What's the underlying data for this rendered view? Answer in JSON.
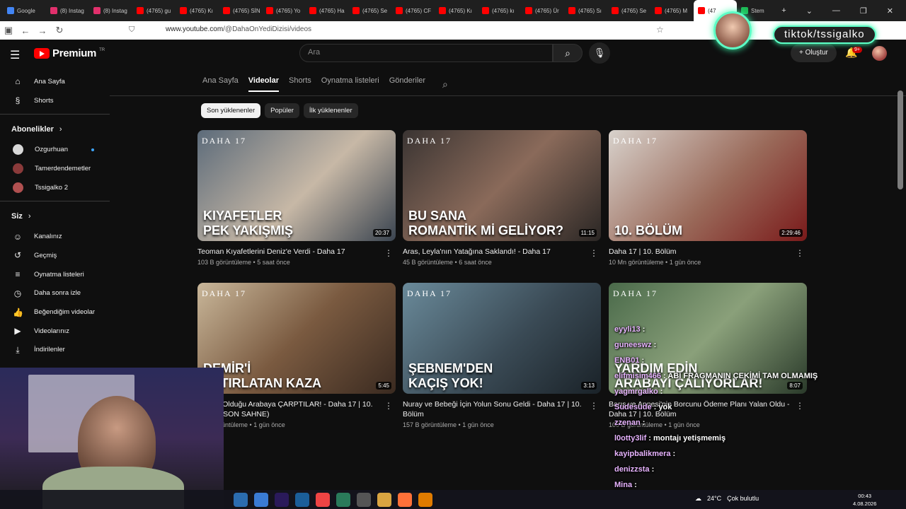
{
  "browser": {
    "tabs": [
      {
        "label": "Google",
        "color": "#4285f4"
      },
      {
        "label": "(8) Instag",
        "color": "#e1306c"
      },
      {
        "label": "(8) Instag",
        "color": "#e1306c"
      },
      {
        "label": "(4765) gu",
        "color": "#ff0000"
      },
      {
        "label": "(4765) Kı",
        "color": "#ff0000"
      },
      {
        "label": "(4765) SİN",
        "color": "#ff0000"
      },
      {
        "label": "(4765) Yo",
        "color": "#ff0000"
      },
      {
        "label": "(4765) Ha",
        "color": "#ff0000"
      },
      {
        "label": "(4765) Se",
        "color": "#ff0000"
      },
      {
        "label": "(4765) CF",
        "color": "#ff0000"
      },
      {
        "label": "(4765) Kı",
        "color": "#ff0000"
      },
      {
        "label": "(4765) kı",
        "color": "#ff0000"
      },
      {
        "label": "(4765) Ür",
        "color": "#ff0000"
      },
      {
        "label": "(4765) Sı",
        "color": "#ff0000"
      },
      {
        "label": "(4765) Se",
        "color": "#ff0000"
      },
      {
        "label": "(4765) M",
        "color": "#ff0000"
      },
      {
        "label": "(47",
        "color": "#ff0000",
        "active": true
      },
      {
        "label": "Stem",
        "color": "#1db954"
      }
    ],
    "new_tab": "+",
    "url_host": "www.youtube.com",
    "url_path": "/@DahaOnYediDizisi/videos"
  },
  "youtube": {
    "logo_text": "Premium",
    "logo_country": "TR",
    "search_placeholder": "Ara",
    "create_label": "Oluştur",
    "notif_count": "9+"
  },
  "sidebar": {
    "main": [
      {
        "label": "Ana Sayfa",
        "icon": "home-icon",
        "glyph": "⌂"
      },
      {
        "label": "Shorts",
        "icon": "shorts-icon",
        "glyph": "§"
      }
    ],
    "subs_title": "Abonelikler",
    "subs": [
      {
        "label": "Ozgurhuan",
        "color": "#d8d8d8",
        "new": true
      },
      {
        "label": "Tamerdendemetler",
        "color": "#8a3a3a",
        "new": false
      },
      {
        "label": "Tssigalko 2",
        "color": "#b05050",
        "new": false
      }
    ],
    "you_title": "Siz",
    "you": [
      {
        "label": "Kanalınız",
        "icon": "account-icon",
        "glyph": "☺"
      },
      {
        "label": "Geçmiş",
        "icon": "history-icon",
        "glyph": "↺"
      },
      {
        "label": "Oynatma listeleri",
        "icon": "playlist-icon",
        "glyph": "≡"
      },
      {
        "label": "Daha sonra izle",
        "icon": "clock-icon",
        "glyph": "◷"
      },
      {
        "label": "Beğendiğim videolar",
        "icon": "like-icon",
        "glyph": "👍"
      },
      {
        "label": "Videolarınız",
        "icon": "your-videos-icon",
        "glyph": "▶"
      },
      {
        "label": "İndirilenler",
        "icon": "download-icon",
        "glyph": "⤓"
      }
    ]
  },
  "channel_tabs": [
    "Ana Sayfa",
    "Videolar",
    "Shorts",
    "Oynatma listeleri",
    "Gönderiler"
  ],
  "active_tab": "Videolar",
  "chips": [
    "Son yüklenenler",
    "Popüler",
    "İlk yüklenenler"
  ],
  "videos": [
    {
      "brand": "DAHA 17",
      "caption": "KIYAFETLER\nPEK YAKIŞMIŞ",
      "duration": "20:37",
      "title": "Teoman Kıyafetlerini Deniz'e Verdi - Daha 17",
      "meta": "103 B görüntüleme • 5 saat önce",
      "bg": "linear-gradient(135deg,#5c6b7a,#c7b8a6 55%,#3a4450)"
    },
    {
      "brand": "DAHA 17",
      "caption": "BU SANA\nROMANTİK Mİ GELİYOR?",
      "duration": "11:15",
      "title": "Aras, Leyla'nın Yatağına Saklandı! - Daha 17",
      "meta": "45 B görüntüleme • 6 saat önce",
      "bg": "linear-gradient(135deg,#3a3432,#8a6a5a 50%,#2a2624)"
    },
    {
      "brand": "DAHA 17",
      "caption": "10. BÖLÜM",
      "duration": "2:29:46",
      "title": "Daha 17 | 10. Bölüm",
      "meta": "10 Mn görüntüleme • 1 gün önce",
      "bg": "linear-gradient(135deg,#d8d2cc,#9a6a5a 55%,#7a1a1a)"
    },
    {
      "brand": "DAHA 17",
      "caption": "DEMİR'İ\nHATIRLATAN KAZA",
      "duration": "5:45",
      "title": "Aras'ın Olduğu Arabaya ÇARPTILAR! - Daha 17 | 10. Bölüm (SON SAHNE)",
      "meta": "52 B görüntüleme • 1 gün önce",
      "bg": "linear-gradient(135deg,#c9b79a,#7a5a40 50%,#3a2a20)"
    },
    {
      "brand": "DAHA 17",
      "caption": "ŞEBNEM'DEN\nKAÇIŞ YOK!",
      "duration": "3:13",
      "title": "Nuray ve Bebeği İçin Yolun Sonu Geldi - Daha 17 | 10. Bölüm",
      "meta": "157 B görüntüleme • 1 gün önce",
      "bg": "linear-gradient(135deg,#6a8a9a,#3a4a55 55%,#1a2228)"
    },
    {
      "brand": "DAHA 17",
      "caption": "YARDIM EDİN\nARABAYI ÇALIYORLAR!",
      "duration": "8:07",
      "title": "Barış ve Annesi'nin Borcunu Ödeme Planı Yalan Oldu - Daha 17 | 10. Bölüm",
      "meta": "100 B görüntüleme • 1 gün önce",
      "bg": "linear-gradient(135deg,#4a6a4a,#8aa07a 50%,#2a3a2a)"
    }
  ],
  "overlays": {
    "tiktok_label": "tiktok/tssigalko",
    "chat": [
      {
        "user": "eyyli13",
        "msg": ""
      },
      {
        "user": "guneeswz",
        "msg": ""
      },
      {
        "user": "ENB01",
        "msg": ""
      },
      {
        "user": "elifmisim466",
        "msg": "ABİ FRAGMANIN ÇEKİMİ TAM OLMAMIŞ"
      },
      {
        "user": "yagmrgalko",
        "msg": ""
      },
      {
        "user": "Sudesude",
        "msg": "yok"
      },
      {
        "user": "zzenan",
        "msg": ""
      },
      {
        "user": "l0otty3lif",
        "msg": "montajı yetişmemiş"
      },
      {
        "user": "kayipbalikmera",
        "msg": ""
      },
      {
        "user": "denizzsta",
        "msg": ""
      },
      {
        "user": "Mina",
        "msg": ""
      }
    ]
  },
  "taskbar": {
    "weather_temp": "24°C",
    "weather_text": "Çok bulutlu",
    "time": "00:43",
    "date": "4.08.2026"
  }
}
